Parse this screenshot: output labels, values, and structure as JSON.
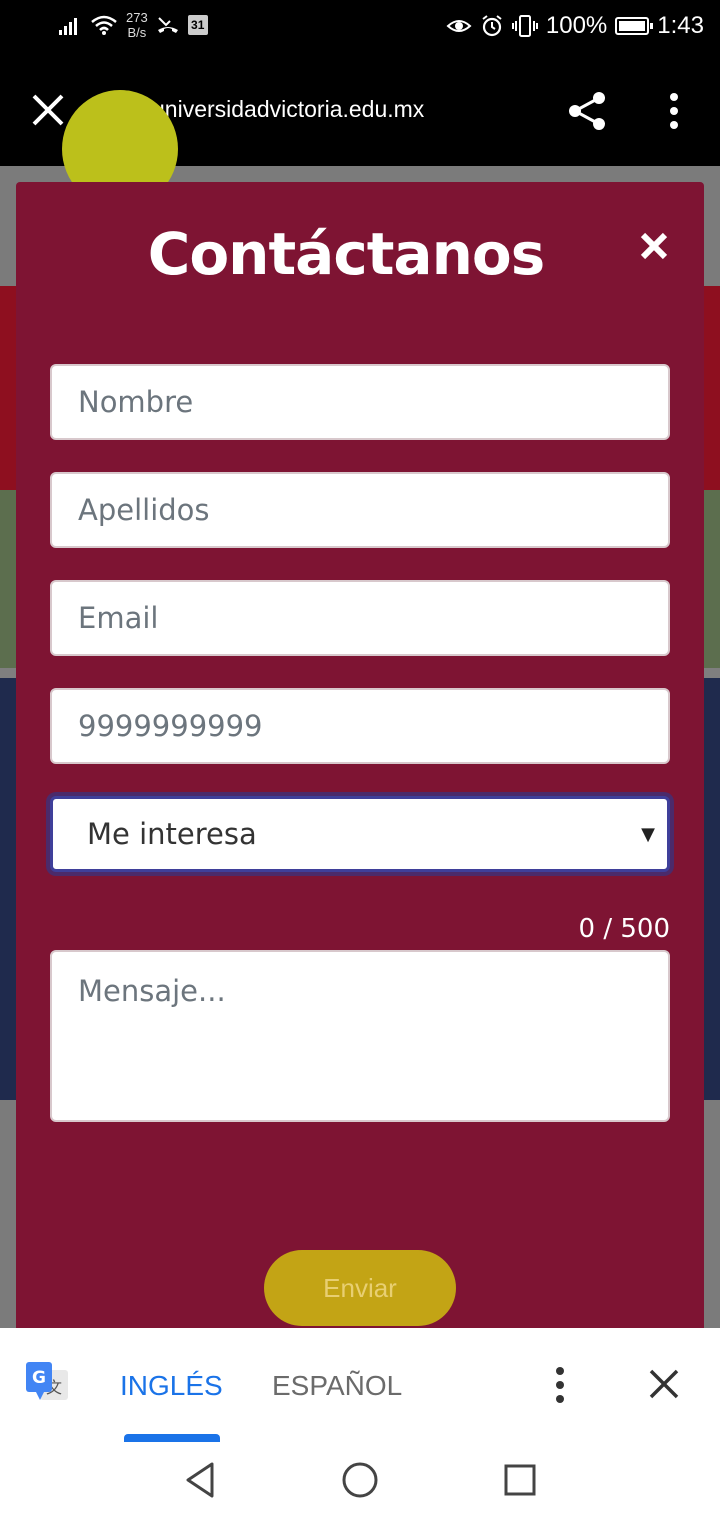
{
  "status_bar": {
    "net_speed_value": "273",
    "net_speed_unit": "B/s",
    "calendar_day": "31",
    "battery": "100%",
    "time": "1:43"
  },
  "browser": {
    "url": "universidadvictoria.edu.mx"
  },
  "modal": {
    "title": "Contáctanos",
    "fields": {
      "nombre_placeholder": "Nombre",
      "apellidos_placeholder": "Apellidos",
      "email_placeholder": "Email",
      "phone_placeholder": "9999999999",
      "interest_selected": "Me interesa",
      "message_placeholder": "Mensaje..."
    },
    "char_counter": "0 / 500",
    "send_label": "Enviar"
  },
  "translate_bar": {
    "lang_active": "INGLÉS",
    "lang_other": "ESPAÑOL"
  },
  "colors": {
    "modal_bg": "#7e1433",
    "send_button": "#c3a415",
    "translate_active": "#1a73e8"
  }
}
